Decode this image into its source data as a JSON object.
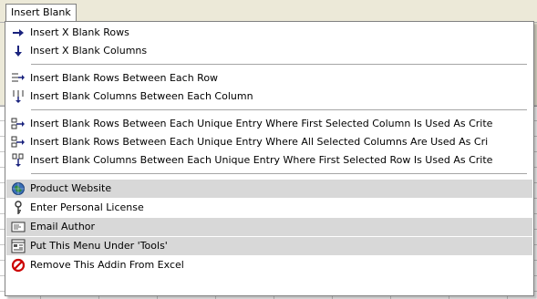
{
  "menubar": {
    "title": "Insert Blank"
  },
  "menu": {
    "items": [
      {
        "label": "Insert X Blank Rows",
        "icon": "arrow-right-icon"
      },
      {
        "label": "Insert X Blank Columns",
        "icon": "arrow-down-icon"
      },
      {
        "label": "Insert Blank Rows Between Each Row",
        "icon": "insert-rows-icon"
      },
      {
        "label": "Insert Blank Columns Between Each Column",
        "icon": "insert-columns-icon"
      },
      {
        "label": "Insert Blank Rows Between Each Unique Entry Where First Selected Column Is Used As Crite",
        "icon": "insert-rows-unique-icon"
      },
      {
        "label": "Insert Blank Rows Between Each Unique Entry Where All Selected Columns Are Used As Cri",
        "icon": "insert-rows-all-icon"
      },
      {
        "label": "Insert Blank Columns Between Each Unique Entry Where First Selected Row Is Used As Crite",
        "icon": "insert-columns-unique-icon"
      },
      {
        "label": "Product Website",
        "icon": "globe-icon"
      },
      {
        "label": "Enter Personal License",
        "icon": "key-icon"
      },
      {
        "label": "Email Author",
        "icon": "email-icon"
      },
      {
        "label": "Put This Menu Under 'Tools'",
        "icon": "menu-tools-icon"
      },
      {
        "label": "Remove This Addin From Excel",
        "icon": "remove-icon"
      }
    ]
  },
  "colors": {
    "menu_shade": "#d8d8d8",
    "remove_red": "#cc0000",
    "arrow_navy": "#1a237e"
  }
}
